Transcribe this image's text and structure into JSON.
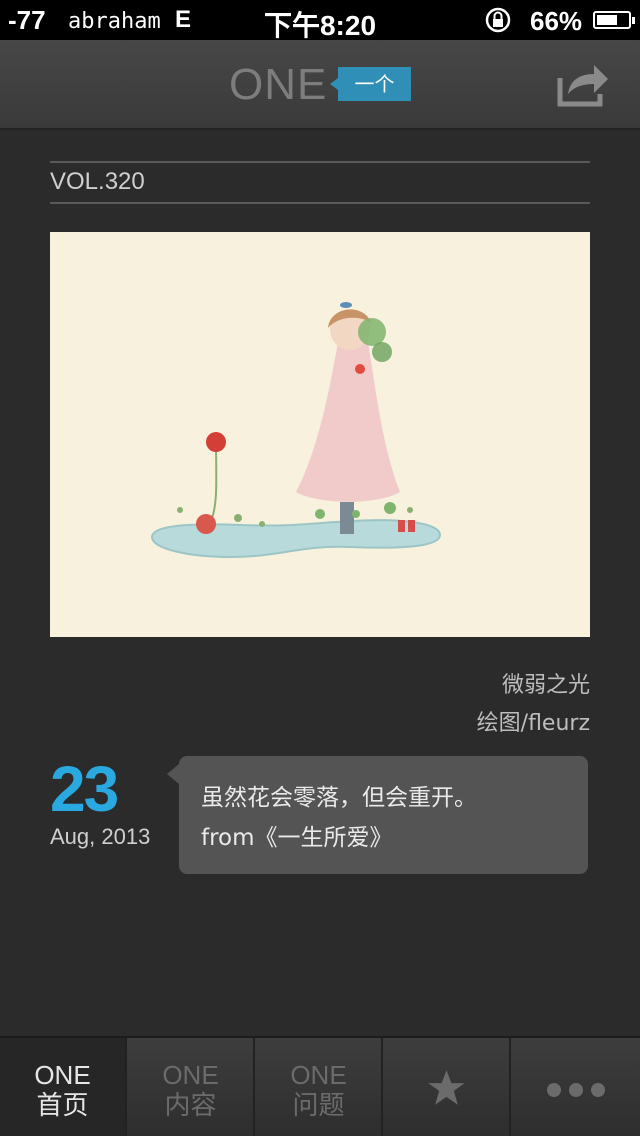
{
  "statusbar": {
    "signal": "-77",
    "carrier": "abraham",
    "network": "E",
    "time": "下午8:20",
    "battery": "66%",
    "battery_level": 0.66
  },
  "header": {
    "logo": "ONE",
    "logo_tag": "一个",
    "share_icon": "share-icon"
  },
  "main": {
    "volume": "VOL.320",
    "artwork_title": "微弱之光",
    "artwork_credit": "绘图/fleurz",
    "date_day": "23",
    "date_month_year": "Aug, 2013",
    "quote_line1": "虽然花会零落，但会重开。",
    "quote_line2": "from《一生所爱》"
  },
  "tabbar": {
    "tabs": [
      {
        "line1": "ONE",
        "line2": "首页"
      },
      {
        "line1": "ONE",
        "line2": "内容"
      },
      {
        "line1": "ONE",
        "line2": "问题"
      },
      {
        "icon": "star-icon"
      },
      {
        "icon": "more-icon"
      }
    ]
  },
  "colors": {
    "accent": "#2aa9e0",
    "logo_tag": "#2f8fb7",
    "background": "#2b2b2b"
  }
}
